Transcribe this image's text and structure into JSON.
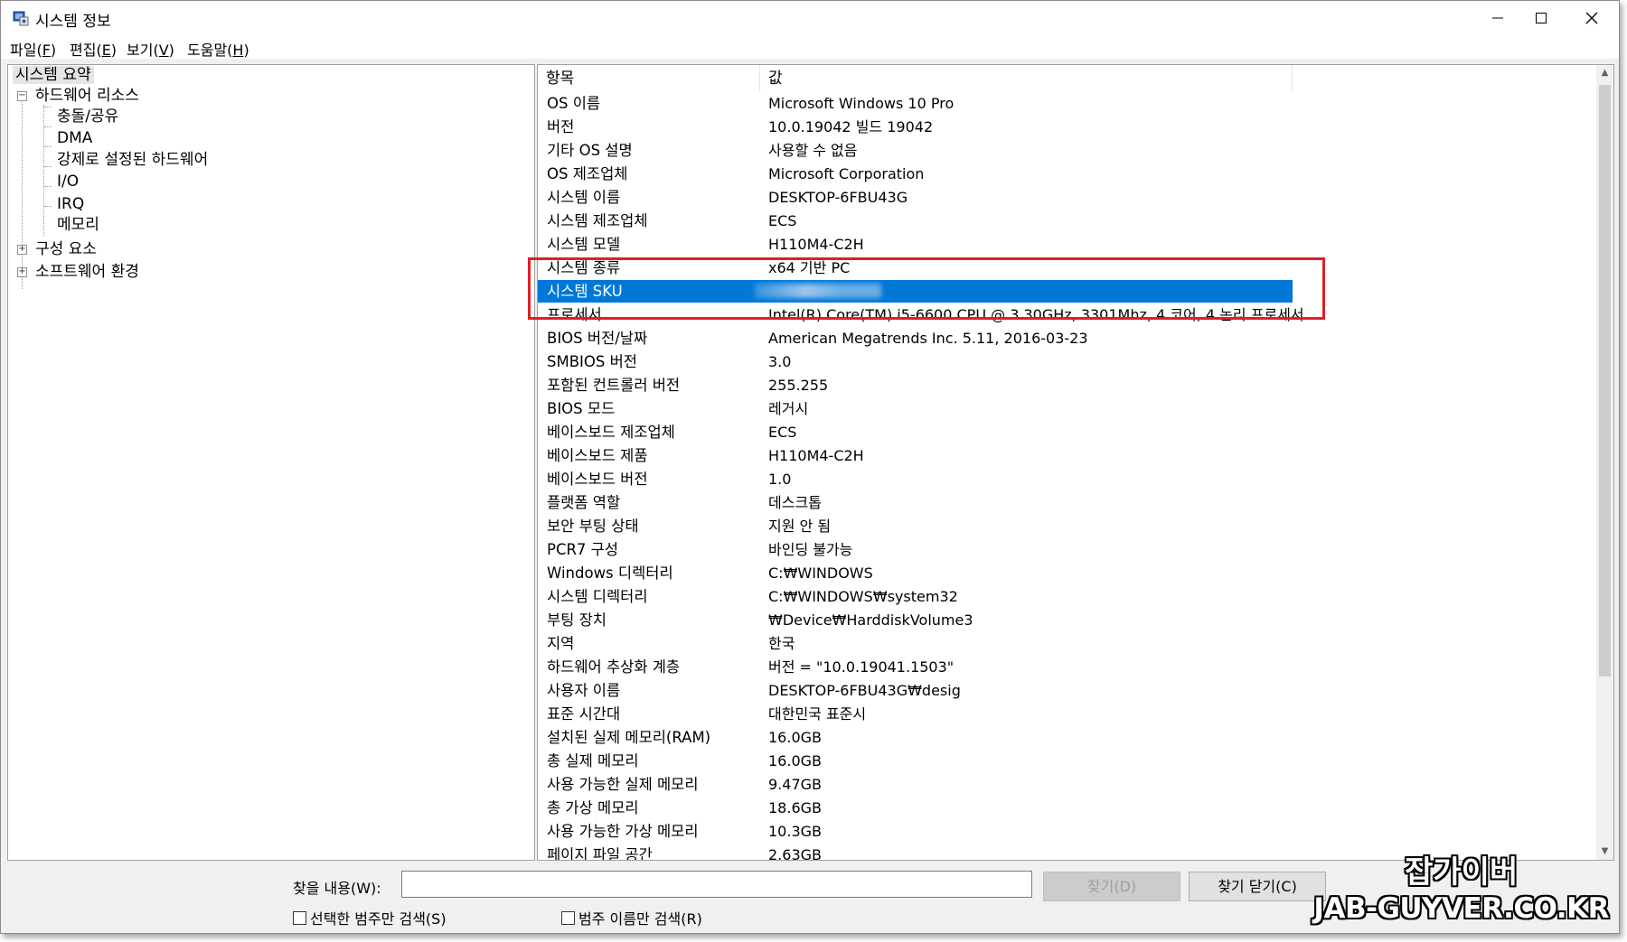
{
  "window": {
    "title": "시스템 정보",
    "icon": "system-info-icon",
    "controls": {
      "minimize": "—",
      "maximize": "☐",
      "close": "✕"
    }
  },
  "menu": [
    {
      "label": "파일(",
      "key": "F",
      "end": ")"
    },
    {
      "label": "편집(",
      "key": "E",
      "end": ")"
    },
    {
      "label": "보기(",
      "key": "V",
      "end": ")"
    },
    {
      "label": "도움말(",
      "key": "H",
      "end": ")"
    }
  ],
  "tree": {
    "root": "시스템 요약",
    "hardware": "하드웨어 리소스",
    "hardware_children": [
      "충돌/공유",
      "DMA",
      "강제로 설정된 하드웨어",
      "I/O",
      "IRQ",
      "메모리"
    ],
    "components": "구성 요소",
    "software": "소프트웨어 환경",
    "expander_open": "−",
    "expander_closed": "+"
  },
  "list": {
    "headers": {
      "item": "항목",
      "value": "값"
    },
    "rows": [
      {
        "item": "OS 이름",
        "value": "Microsoft Windows 10 Pro"
      },
      {
        "item": "버전",
        "value": "10.0.19042 빌드 19042"
      },
      {
        "item": "기타 OS 설명",
        "value": "사용할 수 없음"
      },
      {
        "item": "OS 제조업체",
        "value": "Microsoft Corporation"
      },
      {
        "item": "시스템 이름",
        "value": "DESKTOP-6FBU43G"
      },
      {
        "item": "시스템 제조업체",
        "value": "ECS"
      },
      {
        "item": "시스템 모델",
        "value": "H110M4-C2H"
      },
      {
        "item": "시스템 종류",
        "value": "x64 기반 PC"
      },
      {
        "item": "시스템 SKU",
        "value": ""
      },
      {
        "item": "프로세서",
        "value": "Intel(R) Core(TM) i5-6600 CPU @ 3.30GHz, 3301Mhz, 4 코어, 4 논리 프로세서"
      },
      {
        "item": "BIOS 버전/날짜",
        "value": "American Megatrends Inc. 5.11, 2016-03-23"
      },
      {
        "item": "SMBIOS 버전",
        "value": "3.0"
      },
      {
        "item": "포함된 컨트롤러 버전",
        "value": "255.255"
      },
      {
        "item": "BIOS 모드",
        "value": "레거시"
      },
      {
        "item": "베이스보드 제조업체",
        "value": "ECS"
      },
      {
        "item": "베이스보드 제품",
        "value": "H110M4-C2H"
      },
      {
        "item": "베이스보드 버전",
        "value": "1.0"
      },
      {
        "item": "플랫폼 역할",
        "value": "데스크톱"
      },
      {
        "item": "보안 부팅 상태",
        "value": "지원 안 됨"
      },
      {
        "item": "PCR7 구성",
        "value": "바인딩 불가능"
      },
      {
        "item": "Windows 디렉터리",
        "value": "C:₩WINDOWS"
      },
      {
        "item": "시스템 디렉터리",
        "value": "C:₩WINDOWS₩system32"
      },
      {
        "item": "부팅 장치",
        "value": "₩Device₩HarddiskVolume3"
      },
      {
        "item": "지역",
        "value": "한국"
      },
      {
        "item": "하드웨어 추상화 계층",
        "value": "버전 = \"10.0.19041.1503\""
      },
      {
        "item": "사용자 이름",
        "value": "DESKTOP-6FBU43G₩desig"
      },
      {
        "item": "표준 시간대",
        "value": "대한민국 표준시"
      },
      {
        "item": "설치된 실제 메모리(RAM)",
        "value": "16.0GB"
      },
      {
        "item": "총 실제 메모리",
        "value": "16.0GB"
      },
      {
        "item": "사용 가능한 실제 메모리",
        "value": "9.47GB"
      },
      {
        "item": "총 가상 메모리",
        "value": "18.6GB"
      },
      {
        "item": "사용 가능한 가상 메모리",
        "value": "10.3GB"
      },
      {
        "item": "페이지 파일 공간",
        "value": "2.63GB"
      }
    ],
    "selected_index": 8,
    "highlight_color": "#e21e26",
    "selection_color": "#0078d7"
  },
  "scroll": {
    "up": "▲",
    "down": "▼"
  },
  "find": {
    "label": "찾을 내용(W):",
    "value": "",
    "find_button": "찾기(D)",
    "close_find_button": "찾기 닫기(C)",
    "check_selected_category": "선택한 범주만 검색(S)",
    "check_category_names": "범주 이름만 검색(R)"
  },
  "watermark": {
    "line1": "잡가이버",
    "line2": "JAB-GUYVER.CO.KR"
  }
}
